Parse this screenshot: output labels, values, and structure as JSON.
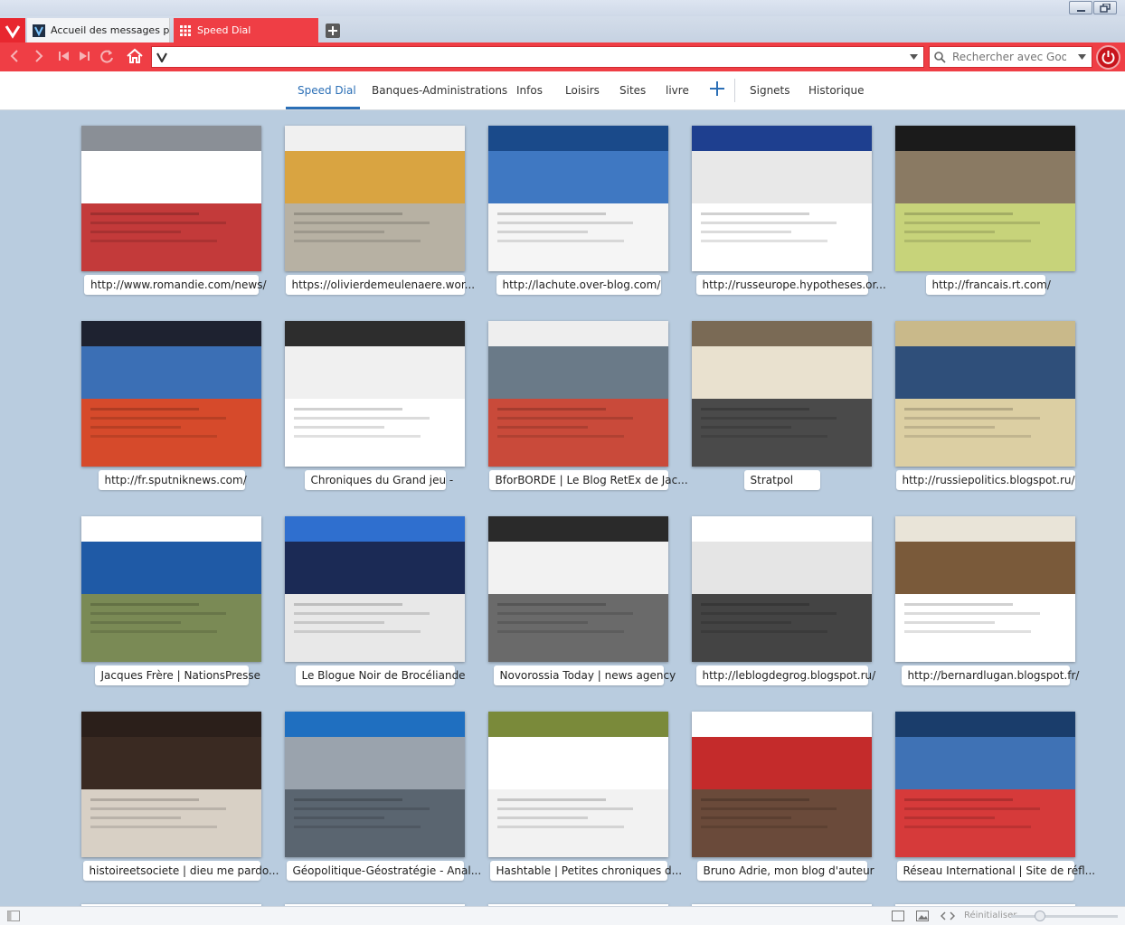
{
  "tabs": [
    {
      "title": "Accueil des messages person",
      "active": false
    },
    {
      "title": "Speed Dial",
      "active": true
    }
  ],
  "address_bar": {
    "value": ""
  },
  "search": {
    "placeholder": "Rechercher avec Google"
  },
  "speed_dial_nav": {
    "tabs": [
      "Speed Dial",
      "Banques-Administrations",
      "Infos",
      "Loisirs",
      "Sites",
      "livre"
    ],
    "extra_tabs": [
      "Signets",
      "Historique"
    ],
    "active": "Speed Dial"
  },
  "dials": [
    {
      "label": "http://www.romandie.com/news/",
      "colors": [
        "#8a8f96",
        "#ffffff",
        "#c33a3a"
      ]
    },
    {
      "label": "https://olivierdemeulenaere.wor...",
      "colors": [
        "#f0f0f0",
        "#d9a441",
        "#b7b1a3"
      ]
    },
    {
      "label": "http://lachute.over-blog.com/",
      "colors": [
        "#1a4a8a",
        "#3f78c2",
        "#f5f5f5"
      ]
    },
    {
      "label": "http://russeurope.hypotheses.or...",
      "colors": [
        "#1e3f8f",
        "#e8e8e8",
        "#ffffff"
      ]
    },
    {
      "label": "http://francais.rt.com/",
      "colors": [
        "#1b1b1b",
        "#8a7a63",
        "#c7d37a"
      ]
    },
    {
      "label": "http://fr.sputniknews.com/",
      "colors": [
        "#1e2230",
        "#3b6fb5",
        "#d64a2b"
      ]
    },
    {
      "label": "Chroniques du Grand jeu -",
      "colors": [
        "#2d2d2d",
        "#f0f0f0",
        "#ffffff"
      ]
    },
    {
      "label": "BforBORDE | Le Blog RetEx de Jac...",
      "colors": [
        "#eeeeee",
        "#6a7a88",
        "#c94a3a"
      ]
    },
    {
      "label": "Stratpol",
      "colors": [
        "#7a6a55",
        "#e9e1cf",
        "#4a4a4a"
      ]
    },
    {
      "label": "http://russiepolitics.blogspot.ru/",
      "colors": [
        "#c9b98a",
        "#2f4f7a",
        "#dccfa3"
      ]
    },
    {
      "label": "Jacques Frère | NationsPresse",
      "colors": [
        "#ffffff",
        "#1f5aa6",
        "#7a8a55"
      ]
    },
    {
      "label": "Le Blogue Noir de Brocéliande",
      "colors": [
        "#2f6fcf",
        "#1b2a55",
        "#e8e8e8"
      ]
    },
    {
      "label": "Novorossia Today | news agency",
      "colors": [
        "#2a2a2a",
        "#f2f2f2",
        "#6a6a6a"
      ]
    },
    {
      "label": "http://leblogdegrog.blogspot.ru/",
      "colors": [
        "#ffffff",
        "#e5e5e5",
        "#444444"
      ]
    },
    {
      "label": "http://bernardlugan.blogspot.fr/",
      "colors": [
        "#e9e4d8",
        "#7a5a3a",
        "#ffffff"
      ]
    },
    {
      "label": "histoireetsociete | dieu me pardo...",
      "colors": [
        "#2b1f1a",
        "#3a2a22",
        "#d8d0c5"
      ]
    },
    {
      "label": "Géopolitique-Géostratégie - Anal...",
      "colors": [
        "#1f6fc0",
        "#9aa3ad",
        "#5a6570"
      ]
    },
    {
      "label": "Hashtable | Petites chroniques d...",
      "colors": [
        "#7a8a3a",
        "#ffffff",
        "#f2f2f2"
      ]
    },
    {
      "label": "Bruno Adrie, mon blog d'auteur",
      "colors": [
        "#ffffff",
        "#c42b2b",
        "#6a4a3a"
      ]
    },
    {
      "label": "Réseau International | Site de réfl...",
      "colors": [
        "#1a3d6b",
        "#3f72b5",
        "#d63a3a"
      ]
    }
  ],
  "status_bar": {
    "reset_label": "Réinitialiser",
    "zoom_level": 0.27
  },
  "icons": [
    "vivaldi-menu-icon",
    "back-icon",
    "forward-icon",
    "rewind-icon",
    "fast-forward-icon",
    "reload-icon",
    "home-icon",
    "vivaldi-v-icon",
    "search-engine-icon",
    "power-icon"
  ]
}
